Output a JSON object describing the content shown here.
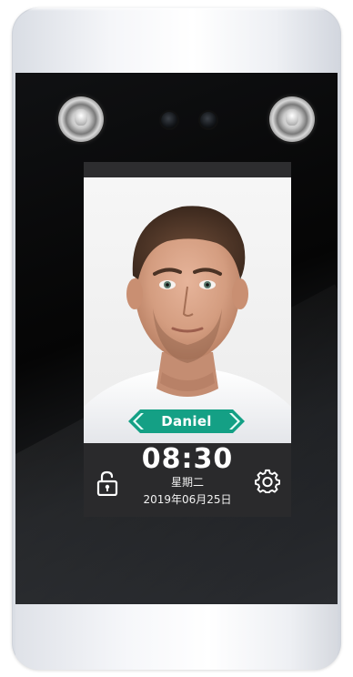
{
  "recognition": {
    "name": "Daniel",
    "name_tag_color": "#14a085"
  },
  "clock": {
    "time": "08:30",
    "weekday": "星期二",
    "date": "2019年06月25日"
  },
  "icons": {
    "unlock": "unlock-icon",
    "settings": "gear-icon"
  },
  "theme": {
    "panel": "#0b0c0e",
    "screen_bar": "#2a2a2c",
    "text": "#ffffff"
  }
}
